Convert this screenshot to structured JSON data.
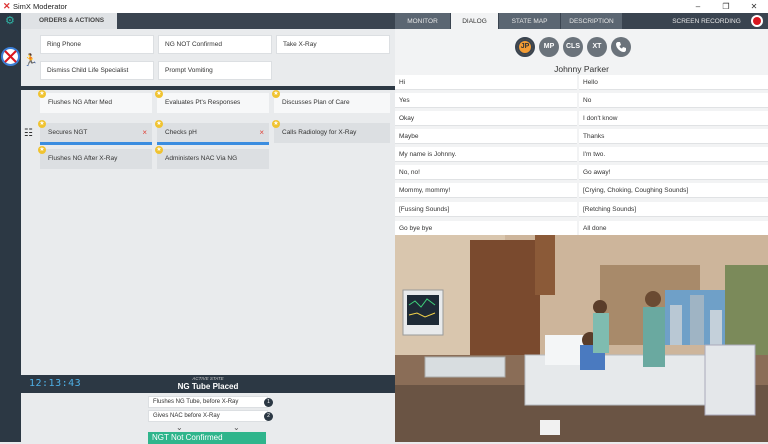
{
  "window": {
    "title": "SimX Moderator",
    "controls": [
      "–",
      "❐",
      "✕"
    ]
  },
  "left_header": {
    "title": "ORDERS & ACTIONS"
  },
  "tabs": [
    {
      "label": "MONITOR",
      "active": false
    },
    {
      "label": "DIALOG",
      "active": true
    },
    {
      "label": "STATE MAP",
      "active": false
    },
    {
      "label": "DESCRIPTION",
      "active": false
    }
  ],
  "screen_recording": "SCREEN RECORDING",
  "orders": [
    "Ring Phone",
    "NG NOT Confirmed",
    "Take X-Ray",
    "Dismiss Child Life Specialist",
    "Prompt Vomiting"
  ],
  "sequence_actions": [
    "Flushes NG After Med",
    "Evaluates Pt's Responses",
    "Discusses Plan of Care",
    "Secures NGT",
    "Checks pH",
    "Calls Radiology for X-Ray",
    "Flushes NG After X-Ray",
    "Administers NAC Via NG"
  ],
  "remove_mark": "×",
  "timer": "12:13:43",
  "state": {
    "label": "ACTIVE STATE",
    "name": "NG Tube Placed"
  },
  "transitions": [
    {
      "label": "Flushes NG Tube, before X-Ray",
      "num": "1"
    },
    {
      "label": "Gives NAC before X-Ray",
      "num": "2"
    }
  ],
  "next_state_button": "NGT Not Confirmed",
  "characters": [
    "JP",
    "MP",
    "CLS",
    "XT"
  ],
  "character_name": "Johnny Parker",
  "dialog_left": [
    "Hi",
    "Yes",
    "Okay",
    "Maybe",
    "My name is Johnny.",
    "No, no!",
    "Mommy, mommy!",
    "[Fussing Sounds]",
    "Go bye bye"
  ],
  "dialog_right": [
    "Hello",
    "No",
    "I don't know",
    "Thanks",
    "I'm two.",
    "Go away!",
    "[Crying, Choking, Coughing Sounds]",
    "[Retching Sounds]",
    "All done"
  ],
  "colors": {
    "accent": "#2fb7a8",
    "dark": "#2c3844",
    "blue": "#3b8de0",
    "record": "#d9161e",
    "star": "#f0c330"
  }
}
